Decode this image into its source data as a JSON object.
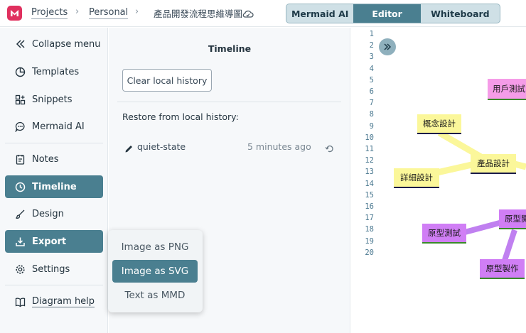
{
  "header": {
    "breadcrumbs": [
      "Projects",
      "Personal"
    ],
    "document_title": "產品開發流程思維導圖",
    "modes": [
      {
        "label": "Mermaid AI",
        "active": false
      },
      {
        "label": "Editor",
        "active": true
      },
      {
        "label": "Whiteboard",
        "active": false
      }
    ]
  },
  "sidebar": {
    "items": [
      {
        "label": "Collapse menu",
        "icon": "collapse-icon"
      },
      {
        "label": "Templates",
        "icon": "templates-icon"
      },
      {
        "label": "Snippets",
        "icon": "snippets-icon"
      },
      {
        "label": "Mermaid AI",
        "icon": "chat-icon"
      },
      {
        "label": "Notes",
        "icon": "notes-icon"
      },
      {
        "label": "Timeline",
        "icon": "clock-icon",
        "active": true
      },
      {
        "label": "Design",
        "icon": "brush-icon"
      },
      {
        "label": "Export",
        "icon": "export-icon",
        "active": true
      },
      {
        "label": "Settings",
        "icon": "gear-icon"
      },
      {
        "label": "Diagram help",
        "icon": "book-icon"
      }
    ]
  },
  "timeline": {
    "title": "Timeline",
    "clear_label": "Clear local history",
    "restore_label": "Restore from local history:",
    "entries": [
      {
        "name": "quiet-state",
        "time": "5 minutes ago"
      }
    ]
  },
  "export_menu": {
    "items": [
      {
        "label": "Image as PNG",
        "active": false
      },
      {
        "label": "Image as SVG",
        "active": true
      },
      {
        "label": "Text as MMD",
        "active": false
      }
    ]
  },
  "editor": {
    "line_numbers": [
      "1",
      "2",
      "3",
      "4",
      "5",
      "6",
      "7",
      "8",
      "9",
      "10",
      "11",
      "12",
      "13",
      "14",
      "15",
      "16",
      "17",
      "18",
      "19",
      "20"
    ]
  },
  "diagram": {
    "nodes": [
      "用戶測試",
      "概念設計",
      "產品設計",
      "詳細設計",
      "原型測試",
      "原型開",
      "原型製作"
    ],
    "colors": {
      "yellow": "#fbf79a",
      "purple": "#d07ef5",
      "pink": "#f59ce8",
      "accent": "#4a7f90"
    }
  }
}
